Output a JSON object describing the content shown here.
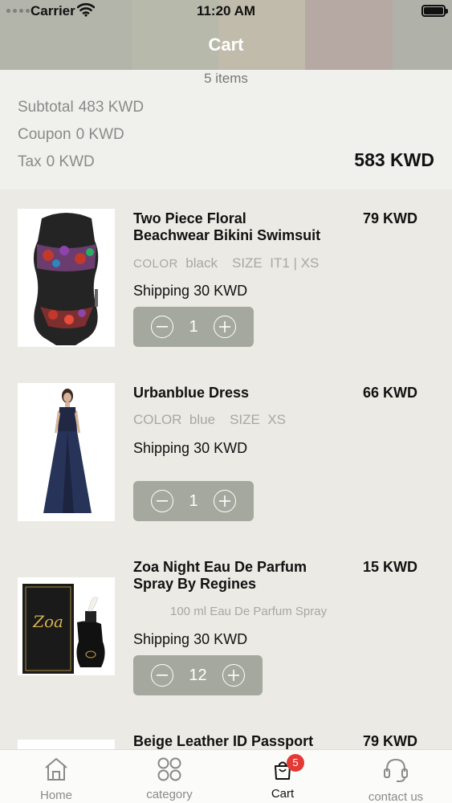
{
  "status_bar": {
    "carrier": "Carrier",
    "time": "11:20 AM"
  },
  "header": {
    "title": "Cart"
  },
  "summary": {
    "items_count": "5 items",
    "subtotal_label": "Subtotal",
    "subtotal_value": "483 KWD",
    "coupon_label": "Coupon",
    "coupon_value": "0 KWD",
    "tax_label": "Tax",
    "tax_value": "0 KWD",
    "total": "583 KWD"
  },
  "items": [
    {
      "name_line1": "Two Piece Floral",
      "name_line2": "Beachwear Bikini Swimsuit",
      "price": "79 KWD",
      "color_label": "COLOR",
      "color_value": "black",
      "size_label": "SIZE",
      "size_value": "IT1 | XS",
      "shipping_label": "Shipping",
      "shipping_value": "30 KWD",
      "quantity": "1"
    },
    {
      "name_line1": "Urbanblue Dress",
      "price": "66 KWD",
      "color_label": "COLOR",
      "color_value": "blue",
      "size_label": "SIZE",
      "size_value": "XS",
      "shipping_label": "Shipping",
      "shipping_value": "30 KWD",
      "quantity": "1"
    },
    {
      "name_line1": "Zoa Night Eau De Parfum",
      "name_line2": "Spray By Regines",
      "price": "15 KWD",
      "variant": "100 ml Eau De Parfum Spray",
      "shipping_label": "Shipping",
      "shipping_value": "30 KWD",
      "quantity": "12",
      "package_text": "Zoa"
    },
    {
      "name_line1": "Beige Leather ID Passport",
      "price": "79 KWD"
    }
  ],
  "tabbar": {
    "home": "Home",
    "category": "category",
    "cart": "Cart",
    "cart_badge": "5",
    "contact": "contact us"
  },
  "colors": {
    "stepper": "#a5a89e",
    "badge": "#e53935",
    "background": "#ebeae4"
  },
  "icons": [
    "wifi-icon",
    "battery-icon",
    "minus-icon",
    "plus-icon",
    "home-icon",
    "grid-icon",
    "cart-icon",
    "headset-icon"
  ]
}
